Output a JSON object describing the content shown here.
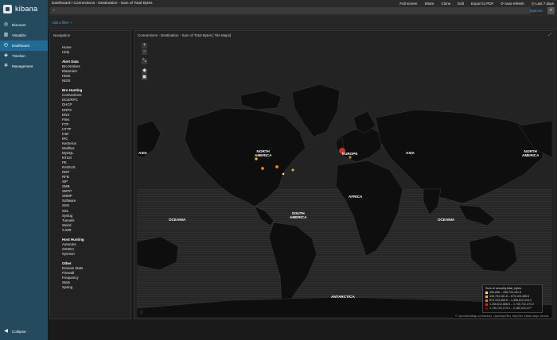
{
  "app": {
    "name": "kibana"
  },
  "sidebar": {
    "items": [
      {
        "label": "Discover",
        "icon": "compass-icon"
      },
      {
        "label": "Visualize",
        "icon": "bar-chart-icon"
      },
      {
        "label": "Dashboard",
        "icon": "dashboard-icon",
        "active": true
      },
      {
        "label": "Timelion",
        "icon": "shield-icon"
      },
      {
        "label": "Management",
        "icon": "gear-icon"
      }
    ],
    "collapse_label": "Collapse"
  },
  "header": {
    "breadcrumb": "Dashboard  /  Connections - Destination - Sum of Total Bytes",
    "menu": [
      "Full screen",
      "Share",
      "Clone",
      "Edit",
      "Export to PDF",
      "Auto-refresh",
      "Last 7 days"
    ],
    "search_placeholder": "*",
    "options_label": "Options",
    "add_filter": "Add a filter +"
  },
  "navigation_panel": {
    "title": "Navigation",
    "groups": [
      {
        "header": "",
        "items": [
          "Home",
          "Help"
        ]
      },
      {
        "header": "Alert Data",
        "items": [
          "Bro Notices",
          "ElastAlert",
          "HIDS",
          "NIDS"
        ]
      },
      {
        "header": "Bro Hunting",
        "items": [
          "Connections",
          "DCE/RPC",
          "DHCP",
          "DNP3",
          "DNS",
          "Files",
          "FTP",
          "HTTP",
          "Intel",
          "IRC",
          "Kerberos",
          "Modbus",
          "MySQL",
          "NTLM",
          "PE",
          "RADIUS",
          "RDP",
          "RFB",
          "SIP",
          "SMB",
          "SMTP",
          "SNMP",
          "Software",
          "SSH",
          "SSL",
          "Syslog",
          "Tunnels",
          "Weird",
          "X.509"
        ]
      },
      {
        "header": "Host Hunting",
        "items": [
          "Autoruns",
          "OSSEC",
          "Sysmon"
        ]
      },
      {
        "header": "Other",
        "items": [
          "Domain Stats",
          "Firewall",
          "Frequency",
          "Stats",
          "Syslog"
        ]
      }
    ]
  },
  "map_panel": {
    "title": "Connections - Destination - Sum of Total Bytes [ Tile Maps]",
    "controls": [
      "+",
      "−"
    ],
    "labels": [
      "ASIA",
      "NORTH\nAMERICA",
      "EUROPE",
      "ASIA",
      "NORTH\nAMERICA",
      "AFRICA",
      "SOUTH\nAMERICA",
      "OCEANIA",
      "OCEANIA",
      "ANTARCTICA"
    ],
    "legend": {
      "title": "Sum of security.total_bytes",
      "rows": [
        {
          "label": "496,668 – 438,704,181.8",
          "color": "#ffe066"
        },
        {
          "label": "438,704,181.8 – 873,103,465.6",
          "color": "#f5b041"
        },
        {
          "label": "873,103,465.6 – 1,306,612,019.4",
          "color": "#e67e22"
        },
        {
          "label": "1,306,612,888.6 – 1,740,722,273.2",
          "color": "#c0392b"
        },
        {
          "label": "1,740,722,273.2 – 2,182,031,477",
          "color": "#8b0000"
        }
      ]
    },
    "attribution": "© OpenStreetMap contributors, OpenMapTiles, MapTiler, Elastic Maps Service"
  }
}
